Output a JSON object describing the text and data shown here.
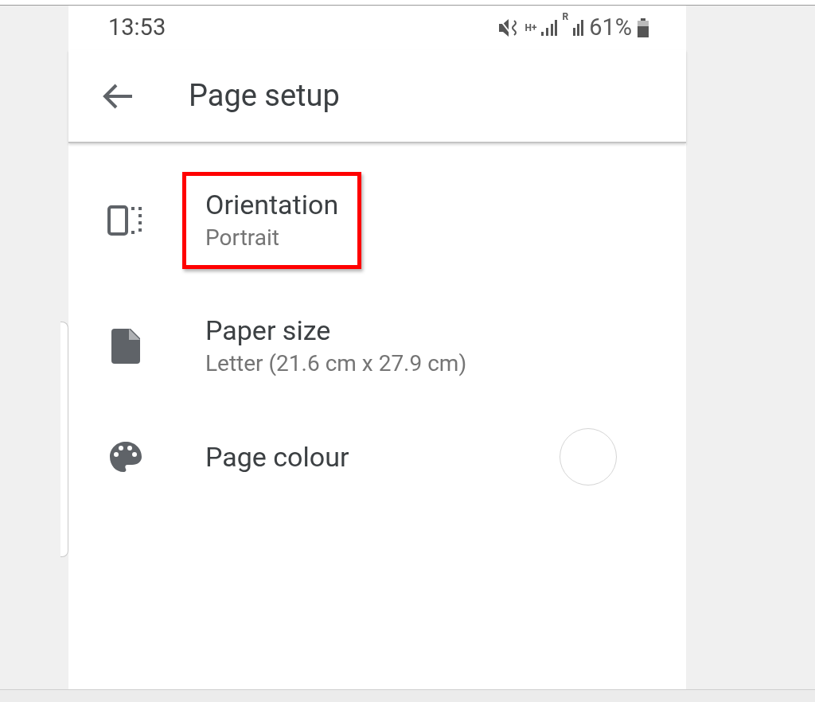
{
  "status_bar": {
    "time": "13:53",
    "network": "H+",
    "roaming": "R",
    "battery": "61%"
  },
  "header": {
    "title": "Page setup"
  },
  "settings": [
    {
      "kind": "orientation",
      "label": "Orientation",
      "value": "Portrait",
      "highlighted": true
    },
    {
      "kind": "paper",
      "label": "Paper size",
      "value": "Letter (21.6 cm x 27.9 cm)",
      "highlighted": false
    },
    {
      "kind": "colour",
      "label": "Page colour",
      "highlighted": false
    }
  ]
}
